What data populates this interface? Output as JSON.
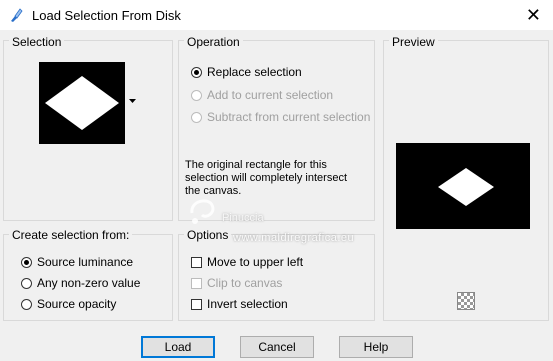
{
  "window": {
    "title": "Load Selection From Disk",
    "close_glyph": "✕"
  },
  "selection_group": {
    "label": "Selection"
  },
  "operation_group": {
    "label": "Operation",
    "options": [
      {
        "label": "Replace selection",
        "selected": true,
        "enabled": true
      },
      {
        "label": "Add to current selection",
        "selected": false,
        "enabled": false
      },
      {
        "label": "Subtract from current selection",
        "selected": false,
        "enabled": false
      }
    ],
    "note": "The original rectangle for this selection will completely intersect the canvas."
  },
  "preview_group": {
    "label": "Preview"
  },
  "create_group": {
    "label": "Create selection from:",
    "options": [
      {
        "label": "Source luminance",
        "selected": true
      },
      {
        "label": "Any non-zero value",
        "selected": false
      },
      {
        "label": "Source opacity",
        "selected": false
      }
    ]
  },
  "options_group": {
    "label": "Options",
    "checks": [
      {
        "label": "Move to upper left",
        "checked": false,
        "enabled": true
      },
      {
        "label": "Clip to canvas",
        "checked": false,
        "enabled": false
      },
      {
        "label": "Invert selection",
        "checked": false,
        "enabled": true
      }
    ]
  },
  "watermark": {
    "name": "Pinuccia",
    "url": "www.maldiregrafica.eu"
  },
  "buttons": {
    "load": "Load",
    "cancel": "Cancel",
    "help": "Help"
  },
  "icons": {
    "app": "app-brush-icon",
    "dropdown": "dropdown-arrow-icon",
    "checker": "transparency-checker-icon"
  }
}
